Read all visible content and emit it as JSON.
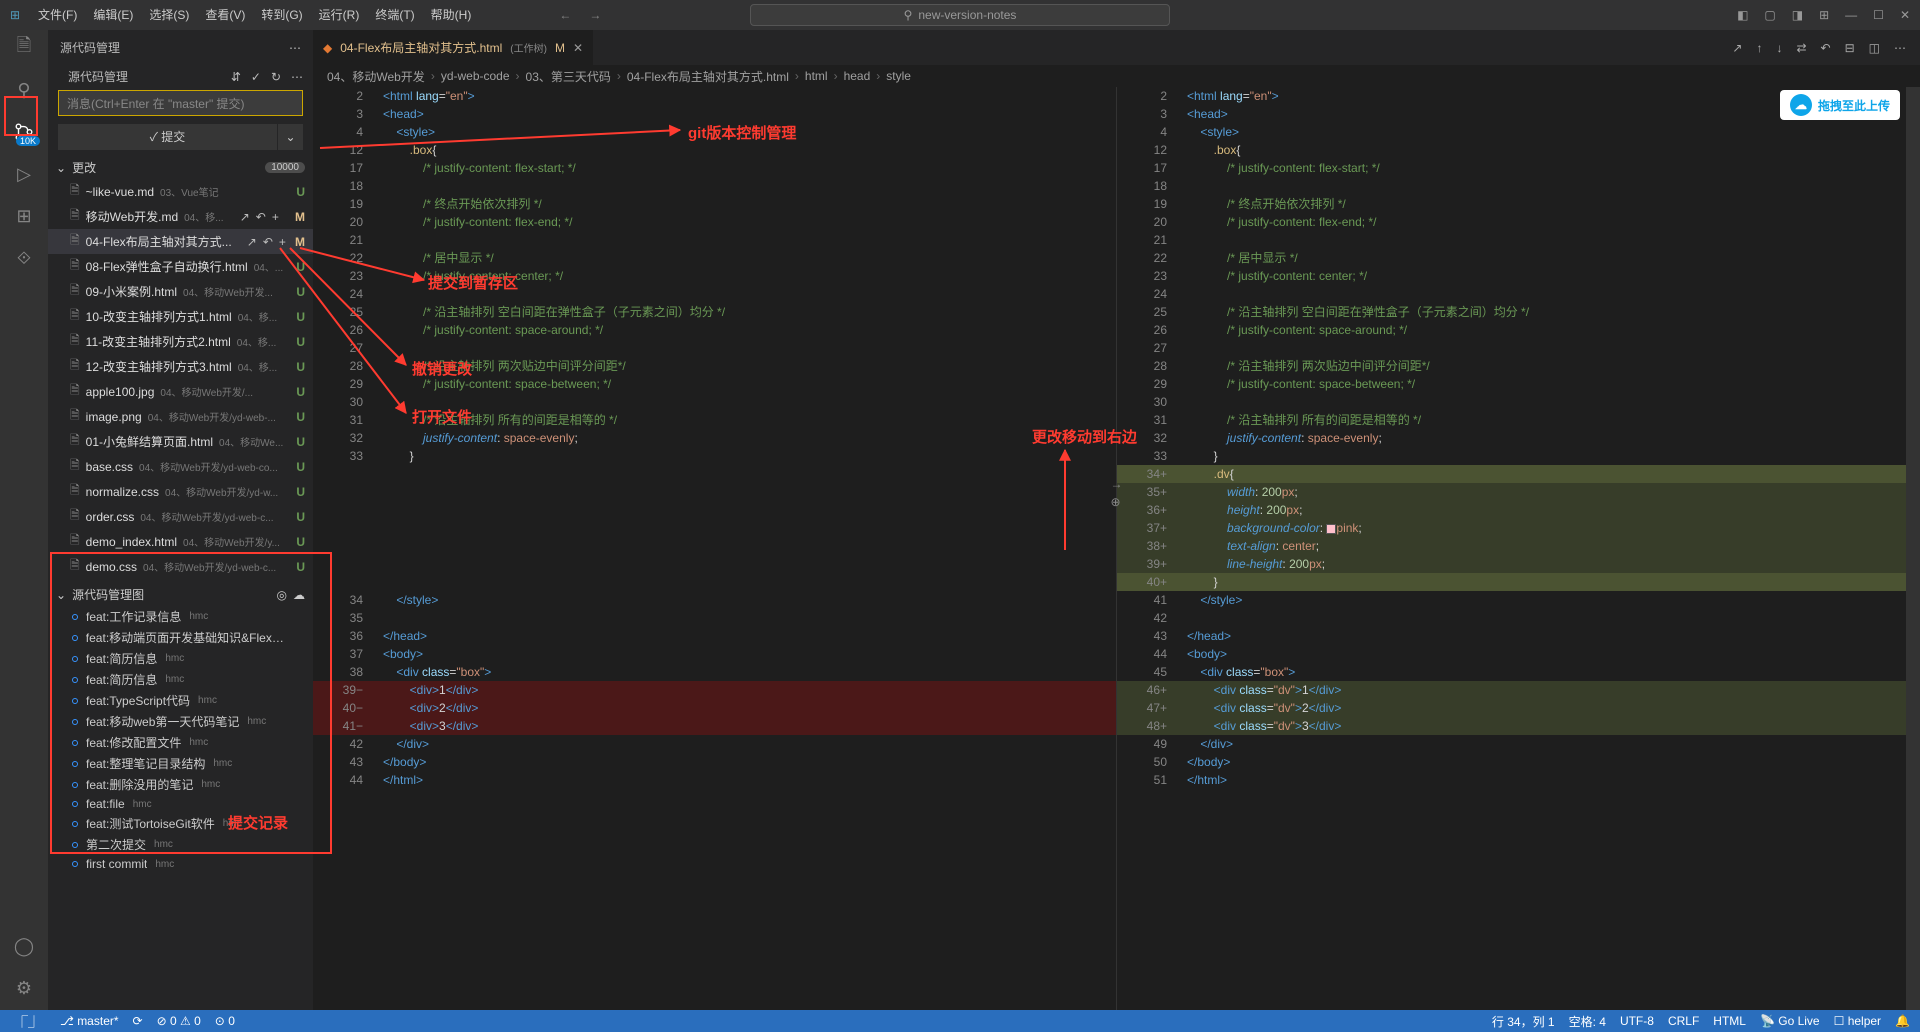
{
  "menu": [
    "文件(F)",
    "编辑(E)",
    "选择(S)",
    "查看(V)",
    "转到(G)",
    "运行(R)",
    "终端(T)",
    "帮助(H)"
  ],
  "search_placeholder": "new-version-notes",
  "sidebar_title": "源代码管理",
  "scm_section_label": "源代码管理",
  "scm_input_placeholder": "消息(Ctrl+Enter 在 \"master\" 提交)",
  "commit_button": "✓ 提交",
  "changes_label": "更改",
  "changes_count": "10000",
  "scm_badge": "10K",
  "files": [
    {
      "name": "~like-vue.md",
      "path": "03、Vue笔记",
      "status": "U"
    },
    {
      "name": "移动Web开发.md",
      "path": "04、移...",
      "status": "M",
      "hovered": true
    },
    {
      "name": "04-Flex布局主轴对其方式...",
      "path": "",
      "status": "M",
      "active": true,
      "hovered": true
    },
    {
      "name": "08-Flex弹性盒子自动换行.html",
      "path": "04、...",
      "status": "U"
    },
    {
      "name": "09-小米案例.html",
      "path": "04、移动Web开发...",
      "status": "U"
    },
    {
      "name": "10-改变主轴排列方式1.html",
      "path": "04、移...",
      "status": "U"
    },
    {
      "name": "11-改变主轴排列方式2.html",
      "path": "04、移...",
      "status": "U"
    },
    {
      "name": "12-改变主轴排列方式3.html",
      "path": "04、移...",
      "status": "U"
    },
    {
      "name": "apple100.jpg",
      "path": "04、移动Web开发/...",
      "status": "U"
    },
    {
      "name": "image.png",
      "path": "04、移动Web开发/yd-web-...",
      "status": "U"
    },
    {
      "name": "01-小兔鲜结算页面.html",
      "path": "04、移动We...",
      "status": "U"
    },
    {
      "name": "base.css",
      "path": "04、移动Web开发/yd-web-co...",
      "status": "U"
    },
    {
      "name": "normalize.css",
      "path": "04、移动Web开发/yd-w...",
      "status": "U"
    },
    {
      "name": "order.css",
      "path": "04、移动Web开发/yd-web-c...",
      "status": "U"
    },
    {
      "name": "demo_index.html",
      "path": "04、移动Web开发/y...",
      "status": "U"
    },
    {
      "name": "demo.css",
      "path": "04、移动Web开发/yd-web-c...",
      "status": "U"
    }
  ],
  "commits_section_label": "源代码管理图",
  "commits": [
    {
      "msg": "feat:工作记录信息",
      "author": "hmc",
      "current": true
    },
    {
      "msg": "feat:移动端页面开发基础知识&Flex布局...",
      "author": ""
    },
    {
      "msg": "feat:简历信息",
      "author": "hmc"
    },
    {
      "msg": "feat:简历信息",
      "author": "hmc"
    },
    {
      "msg": "feat:TypeScript代码",
      "author": "hmc"
    },
    {
      "msg": "feat:移动web第一天代码笔记",
      "author": "hmc"
    },
    {
      "msg": "feat:修改配置文件",
      "author": "hmc"
    },
    {
      "msg": "feat:整理笔记目录结构",
      "author": "hmc"
    },
    {
      "msg": "feat:删除没用的笔记",
      "author": "hmc"
    },
    {
      "msg": "feat:file",
      "author": "hmc"
    },
    {
      "msg": "feat:测试TortoiseGit软件",
      "author": "hmc"
    },
    {
      "msg": "第二次提交",
      "author": "hmc"
    },
    {
      "msg": "first commit",
      "author": "hmc"
    }
  ],
  "tab": {
    "name": "04-Flex布局主轴对其方式.html",
    "suffix": "(工作树)",
    "status": "M"
  },
  "breadcrumb": [
    "04、移动Web开发",
    "yd-web-code",
    "03、第三天代码",
    "04-Flex布局主轴对其方式.html",
    "html",
    "head",
    "style"
  ],
  "upload_badge": "拖拽至此上传",
  "annotations": {
    "a1": "git版本控制管理",
    "a2": "提交到暂存区",
    "a3": "撤销更改",
    "a4": "打开文件",
    "a5": "更改移动到右边",
    "a6": "提交记录"
  },
  "statusbar": {
    "branch": "master*",
    "errors": "0",
    "warnings": "0",
    "ports": "0",
    "ln_col": "行 34，列 1",
    "spaces": "空格: 4",
    "encoding": "UTF-8",
    "eol": "CRLF",
    "lang": "HTML",
    "golive": "Go Live",
    "helper": "helper"
  },
  "code_left": [
    {
      "n": "2",
      "html": "<span class='tok-tag'>&lt;html</span> <span class='tok-attr'>lang</span>=<span class='tok-str'>\"en\"</span><span class='tok-tag'>&gt;</span>"
    },
    {
      "n": "3",
      "html": "<span class='tok-tag'>&lt;head&gt;</span>"
    },
    {
      "n": "4",
      "html": "    <span class='tok-tag'>&lt;style&gt;</span>"
    },
    {
      "n": "12",
      "html": "        <span class='tok-sel'>.box</span>{"
    },
    {
      "n": "17",
      "html": "            <span class='tok-cmt'>/* justify-content: flex-start; */</span>"
    },
    {
      "n": "18",
      "html": ""
    },
    {
      "n": "19",
      "html": "            <span class='tok-cmt'>/* 终点开始依次排列 */</span>"
    },
    {
      "n": "20",
      "html": "            <span class='tok-cmt'>/* justify-content: flex-end; */</span>"
    },
    {
      "n": "21",
      "html": ""
    },
    {
      "n": "22",
      "html": "            <span class='tok-cmt'>/* 居中显示 */</span>"
    },
    {
      "n": "23",
      "html": "            <span class='tok-cmt'>/* justify-content: center; */</span>"
    },
    {
      "n": "24",
      "html": ""
    },
    {
      "n": "25",
      "html": "            <span class='tok-cmt'>/* 沿主轴排列 空白间距在弹性盒子（子元素之间）均分 */</span>"
    },
    {
      "n": "26",
      "html": "            <span class='tok-cmt'>/* justify-content: space-around; */</span>"
    },
    {
      "n": "27",
      "html": ""
    },
    {
      "n": "28",
      "html": "            <span class='tok-cmt'>/* 沿主轴排列 两次贴边中间评分间距*/</span>"
    },
    {
      "n": "29",
      "html": "            <span class='tok-cmt'>/* justify-content: space-between; */</span>"
    },
    {
      "n": "30",
      "html": ""
    },
    {
      "n": "31",
      "html": "            <span class='tok-cmt'>/* 沿主轴排列 所有的间距是相等的 */</span>"
    },
    {
      "n": "32",
      "html": "            <span class='tok-propi'>justify-content</span>: <span class='tok-str'>space-evenly</span>;"
    },
    {
      "n": "33",
      "html": "        }"
    },
    {
      "n": "",
      "html": ""
    },
    {
      "n": "",
      "html": ""
    },
    {
      "n": "",
      "html": ""
    },
    {
      "n": "",
      "html": ""
    },
    {
      "n": "",
      "html": ""
    },
    {
      "n": "",
      "html": ""
    },
    {
      "n": "",
      "html": ""
    },
    {
      "n": "34",
      "html": "    <span class='tok-tag'>&lt;/style&gt;</span>"
    },
    {
      "n": "35",
      "html": ""
    },
    {
      "n": "36",
      "html": "<span class='tok-tag'>&lt;/head&gt;</span>"
    },
    {
      "n": "37",
      "html": "<span class='tok-tag'>&lt;body&gt;</span>"
    },
    {
      "n": "38",
      "html": "    <span class='tok-tag'>&lt;div</span> <span class='tok-attr'>class</span>=<span class='tok-str'>\"box\"</span><span class='tok-tag'>&gt;</span>"
    },
    {
      "n": "39",
      "html": "        <span class='tok-tag'>&lt;div&gt;</span>1<span class='tok-tag'>&lt;/div&gt;</span>",
      "cls": "line-del",
      "gm": "−"
    },
    {
      "n": "40",
      "html": "        <span class='tok-tag'>&lt;div&gt;</span>2<span class='tok-tag'>&lt;/div&gt;</span>",
      "cls": "line-del",
      "gm": "−"
    },
    {
      "n": "41",
      "html": "        <span class='tok-tag'>&lt;div&gt;</span>3<span class='tok-tag'>&lt;/div&gt;</span>",
      "cls": "line-del",
      "gm": "−"
    },
    {
      "n": "42",
      "html": "    <span class='tok-tag'>&lt;/div&gt;</span>"
    },
    {
      "n": "43",
      "html": "<span class='tok-tag'>&lt;/body&gt;</span>"
    },
    {
      "n": "44",
      "html": "<span class='tok-tag'>&lt;/html&gt;</span>"
    }
  ],
  "code_right": [
    {
      "n": "2",
      "html": "<span class='tok-tag'>&lt;html</span> <span class='tok-attr'>lang</span>=<span class='tok-str'>\"en\"</span><span class='tok-tag'>&gt;</span>"
    },
    {
      "n": "3",
      "html": "<span class='tok-tag'>&lt;head&gt;</span>"
    },
    {
      "n": "4",
      "html": "    <span class='tok-tag'>&lt;style&gt;</span>"
    },
    {
      "n": "12",
      "html": "        <span class='tok-sel'>.box</span>{"
    },
    {
      "n": "17",
      "html": "            <span class='tok-cmt'>/* justify-content: flex-start; */</span>"
    },
    {
      "n": "18",
      "html": ""
    },
    {
      "n": "19",
      "html": "            <span class='tok-cmt'>/* 终点开始依次排列 */</span>"
    },
    {
      "n": "20",
      "html": "            <span class='tok-cmt'>/* justify-content: flex-end; */</span>"
    },
    {
      "n": "21",
      "html": ""
    },
    {
      "n": "22",
      "html": "            <span class='tok-cmt'>/* 居中显示 */</span>"
    },
    {
      "n": "23",
      "html": "            <span class='tok-cmt'>/* justify-content: center; */</span>"
    },
    {
      "n": "24",
      "html": ""
    },
    {
      "n": "25",
      "html": "            <span class='tok-cmt'>/* 沿主轴排列 空白间距在弹性盒子（子元素之间）均分 */</span>"
    },
    {
      "n": "26",
      "html": "            <span class='tok-cmt'>/* justify-content: space-around; */</span>"
    },
    {
      "n": "27",
      "html": ""
    },
    {
      "n": "28",
      "html": "            <span class='tok-cmt'>/* 沿主轴排列 两次贴边中间评分间距*/</span>"
    },
    {
      "n": "29",
      "html": "            <span class='tok-cmt'>/* justify-content: space-between; */</span>"
    },
    {
      "n": "30",
      "html": ""
    },
    {
      "n": "31",
      "html": "            <span class='tok-cmt'>/* 沿主轴排列 所有的间距是相等的 */</span>"
    },
    {
      "n": "32",
      "html": "            <span class='tok-propi'>justify-content</span>: <span class='tok-str'>space-evenly</span>;"
    },
    {
      "n": "33",
      "html": "        }"
    },
    {
      "n": "34",
      "html": "        <span class='tok-sel'>.dv</span>{",
      "cls": "line-add-hi",
      "gm": "+"
    },
    {
      "n": "35",
      "html": "            <span class='tok-propi'>width</span>: <span class='tok-num'>200</span><span class='tok-unit'>px</span>;",
      "cls": "line-add",
      "gm": "+"
    },
    {
      "n": "36",
      "html": "            <span class='tok-propi'>height</span>: <span class='tok-num'>200</span><span class='tok-unit'>px</span>;",
      "cls": "line-add",
      "gm": "+"
    },
    {
      "n": "37",
      "html": "            <span class='tok-propi'>background-color</span>: <span class='color-swatch'></span><span class='tok-str'>pink</span>;",
      "cls": "line-add",
      "gm": "+"
    },
    {
      "n": "38",
      "html": "            <span class='tok-propi'>text-align</span>: <span class='tok-str'>center</span>;",
      "cls": "line-add",
      "gm": "+"
    },
    {
      "n": "39",
      "html": "            <span class='tok-propi'>line-height</span>: <span class='tok-num'>200</span><span class='tok-unit'>px</span>;",
      "cls": "line-add",
      "gm": "+"
    },
    {
      "n": "40",
      "html": "        }",
      "cls": "line-add-hi",
      "gm": "+"
    },
    {
      "n": "41",
      "html": "    <span class='tok-tag'>&lt;/style&gt;</span>"
    },
    {
      "n": "42",
      "html": ""
    },
    {
      "n": "43",
      "html": "<span class='tok-tag'>&lt;/head&gt;</span>"
    },
    {
      "n": "44",
      "html": "<span class='tok-tag'>&lt;body&gt;</span>"
    },
    {
      "n": "45",
      "html": "    <span class='tok-tag'>&lt;div</span> <span class='tok-attr'>class</span>=<span class='tok-str'>\"box\"</span><span class='tok-tag'>&gt;</span>"
    },
    {
      "n": "46",
      "html": "        <span class='tok-tag'>&lt;div</span> <span class='tok-attr'>class</span>=<span class='tok-str'>\"dv\"</span><span class='tok-tag'>&gt;</span>1<span class='tok-tag'>&lt;/div&gt;</span>",
      "cls": "line-add",
      "gm": "+"
    },
    {
      "n": "47",
      "html": "        <span class='tok-tag'>&lt;div</span> <span class='tok-attr'>class</span>=<span class='tok-str'>\"dv\"</span><span class='tok-tag'>&gt;</span>2<span class='tok-tag'>&lt;/div&gt;</span>",
      "cls": "line-add",
      "gm": "+"
    },
    {
      "n": "48",
      "html": "        <span class='tok-tag'>&lt;div</span> <span class='tok-attr'>class</span>=<span class='tok-str'>\"dv\"</span><span class='tok-tag'>&gt;</span>3<span class='tok-tag'>&lt;/div&gt;</span>",
      "cls": "line-add",
      "gm": "+"
    },
    {
      "n": "49",
      "html": "    <span class='tok-tag'>&lt;/div&gt;</span>"
    },
    {
      "n": "50",
      "html": "<span class='tok-tag'>&lt;/body&gt;</span>"
    },
    {
      "n": "51",
      "html": "<span class='tok-tag'>&lt;/html&gt;</span>"
    }
  ]
}
